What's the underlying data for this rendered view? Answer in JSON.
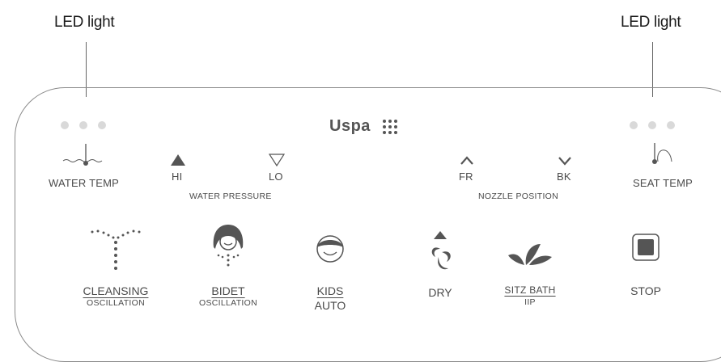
{
  "callouts": {
    "left": "LED light",
    "right": "LED light"
  },
  "brand": {
    "name": "Uspa"
  },
  "top_controls": {
    "water_temp": "WATER TEMP",
    "seat_temp": "SEAT TEMP",
    "hi": "HI",
    "lo": "LO",
    "water_pressure": "WATER PRESSURE",
    "fr": "FR",
    "bk": "BK",
    "nozzle_position": "NOZZLE POSITION"
  },
  "buttons": {
    "cleansing": {
      "top": "CLEANSING",
      "bottom": "OSCILLATION"
    },
    "bidet": {
      "top": "BIDET",
      "bottom": "OSCILLATION"
    },
    "kids": {
      "top": "KIDS",
      "bottom": "AUTO"
    },
    "dry": {
      "label": "DRY"
    },
    "sitz": {
      "top": "SITZ BATH",
      "bottom": "IIP"
    },
    "stop": {
      "label": "STOP"
    }
  },
  "colors": {
    "panel_border": "#8a8a8a",
    "led_dot": "#d9d9d9",
    "icon": "#555555"
  }
}
